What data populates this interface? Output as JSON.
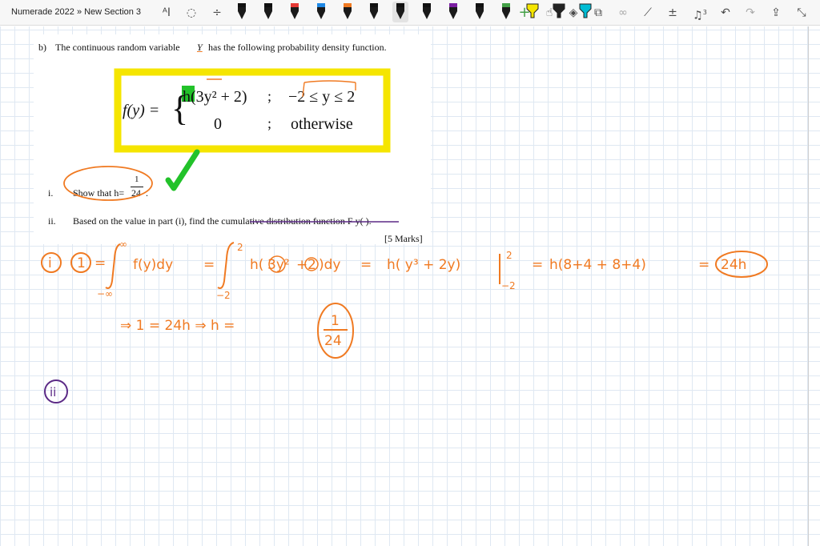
{
  "toolbar": {
    "breadcrumb": "Numerade 2022 » New Section 3",
    "zoom_badge": "3",
    "pens": [
      {
        "name": "black-pen-1",
        "color": "#111111"
      },
      {
        "name": "black-pen-2",
        "color": "#111111"
      },
      {
        "name": "red-pen",
        "color": "#e53935"
      },
      {
        "name": "blue-pen",
        "color": "#1e88e5"
      },
      {
        "name": "orange-pen",
        "color": "#f07a22"
      },
      {
        "name": "black-pen-3",
        "color": "#111111"
      },
      {
        "name": "black-pen-selected",
        "color": "#111111"
      },
      {
        "name": "black-pen-4",
        "color": "#111111"
      },
      {
        "name": "purple-pen",
        "color": "#7b1fa2"
      },
      {
        "name": "black-pen-5",
        "color": "#111111"
      },
      {
        "name": "green-pen",
        "color": "#43a047"
      },
      {
        "name": "yellow-highlighter",
        "color": "#f5e500"
      },
      {
        "name": "black-highlighter",
        "color": "#222222"
      },
      {
        "name": "cyan-highlighter",
        "color": "#00bcd4"
      }
    ]
  },
  "document": {
    "part_label": "b)",
    "intro": "The continuous random variable",
    "variable": "Y",
    "intro_rest": "has the following probability density function.",
    "pdf_lhs": "f(y) =",
    "pdf_case1": "h(3y² + 2)",
    "pdf_sep1": ";",
    "pdf_cond1": "−2 ≤ y ≤ 2",
    "pdf_case2": "0",
    "pdf_sep2": ";",
    "pdf_cond2": "otherwise",
    "item_i_label": "i.",
    "item_i_text": "Show that h=",
    "item_i_num": "1",
    "item_i_den": "24",
    "item_i_end": ".",
    "item_ii_label": "ii.",
    "item_ii_text": "Based on the value in part (i), find the cumulative distribution function F y( ).",
    "marks": "[5 Marks]"
  },
  "handwriting": {
    "part_i_marker": "i",
    "line1": "1 = ∫ f(y)dy = ∫ h(3y²+2)dy = h( y³ + 2y)|  = h(8+4 + 8+4) = 24h",
    "line1_lower_inf": "−∞",
    "line1_upper_inf": "∞",
    "line1_lower_2": "−2",
    "line1_upper_2": "2",
    "line2": "⇒ 1 = 24h ⇒ h =",
    "answer_num": "1",
    "answer_den": "24",
    "part_ii_marker": "ii"
  },
  "colors": {
    "highlight_yellow": "#f5e500",
    "ink_orange": "#f07a22",
    "ink_purple": "#5b2a86",
    "ink_green": "#22c22a",
    "grid_line": "#dfe8f2"
  }
}
